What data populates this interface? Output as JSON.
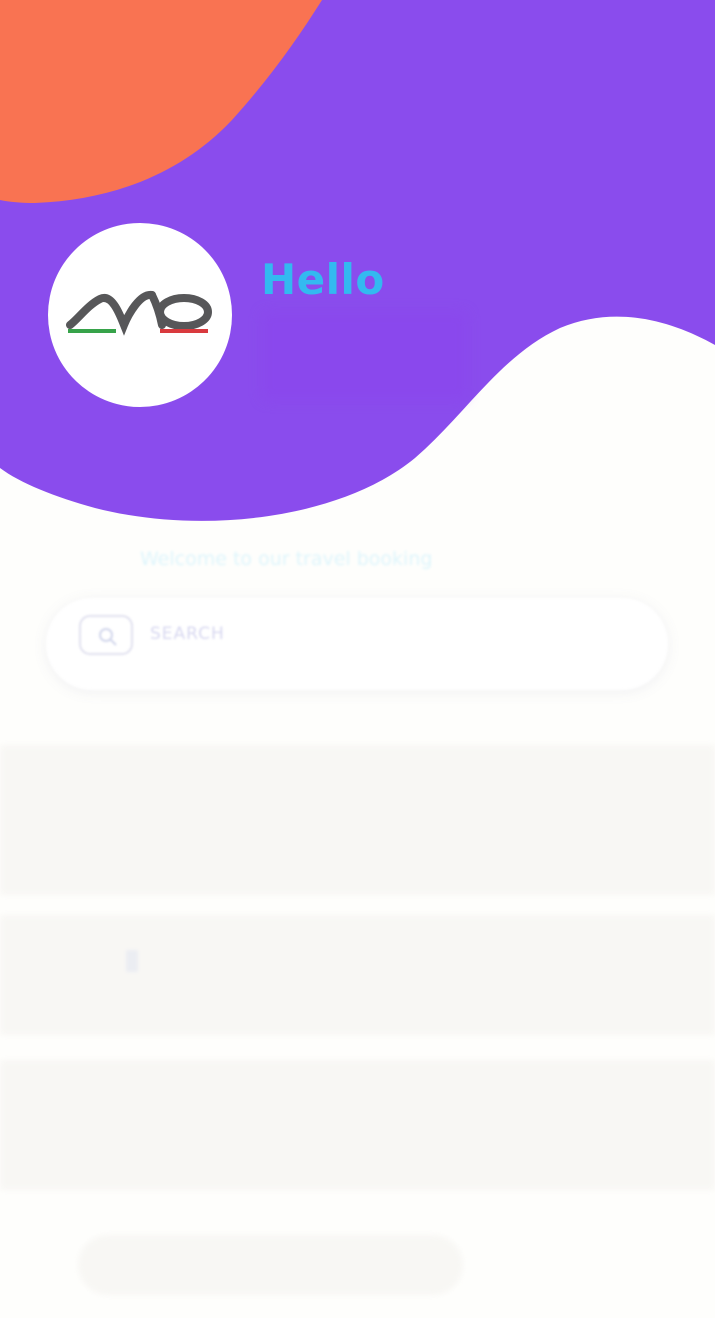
{
  "header": {
    "greeting": "Hello",
    "logo_alt": "UNO"
  },
  "colors": {
    "purple": "#8a4ced",
    "orange": "#f97352",
    "greeting_blue": "#33b9f0",
    "logo_gray": "#575759",
    "logo_green": "#37a34a",
    "logo_red": "#d93a3e"
  },
  "welcome": {
    "text": "Welcome to our travel booking"
  },
  "search": {
    "placeholder": "SEARCH",
    "icon": "search-icon"
  }
}
